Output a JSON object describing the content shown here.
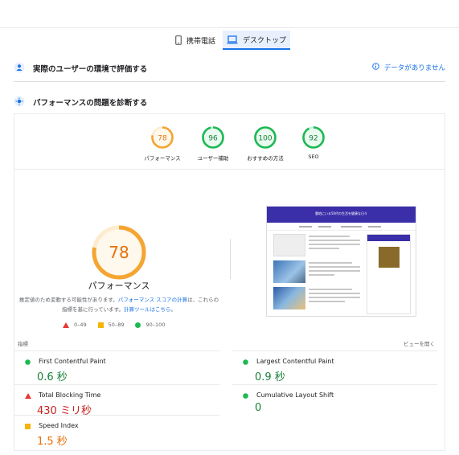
{
  "tabs": [
    {
      "label": "携帯電話",
      "icon": "smartphone-icon"
    },
    {
      "label": "デスクトップ",
      "icon": "laptop-icon",
      "selected": true
    }
  ],
  "field_section": {
    "title": "実際のユーザーの環境で評価する",
    "status": "データがありません"
  },
  "diagnose_section": {
    "title": "パフォーマンスの問題を診断する"
  },
  "category_scores": [
    {
      "label": "パフォーマンス",
      "score": "78",
      "color": "#f4a532"
    },
    {
      "label": "ユーザー補助",
      "score": "96",
      "color": "#1db954"
    },
    {
      "label": "おすすめの方法",
      "score": "100",
      "color": "#1db954"
    },
    {
      "label": "SEO",
      "score": "92",
      "color": "#1db954"
    }
  ],
  "main_score": {
    "value": "78",
    "value_fraction": 0.78,
    "label": "パフォーマンス",
    "note_prefix": "推定値のため変動する可能性があります。",
    "note_link1": "パフォーマンス スコアの計算",
    "note_mid": "は、これらの指標を基に行っています。",
    "note_link2": "計算ツールはこちら",
    "note_suffix": "。"
  },
  "legend": [
    {
      "range": "0–49"
    },
    {
      "range": "50–89"
    },
    {
      "range": "90–100"
    }
  ],
  "screenshot": {
    "header_title": "農地にいる50代の生活を健康な日々"
  },
  "metrics_header": {
    "left": "指標",
    "right": "ビューを開く"
  },
  "metrics": [
    {
      "name": "First Contentful Paint",
      "value": "0.6 秒",
      "status": "good"
    },
    {
      "name": "Largest Contentful Paint",
      "value": "0.9 秒",
      "status": "good"
    },
    {
      "name": "Total Blocking Time",
      "value": "430 ミリ秒",
      "status": "poor"
    },
    {
      "name": "Cumulative Layout Shift",
      "value": "0",
      "status": "good"
    },
    {
      "name": "Speed Index",
      "value": "1.5 秒",
      "status": "average"
    }
  ],
  "colors": {
    "good": "#1db954",
    "average": "#f4b400",
    "poor": "#e53935",
    "accent": "#1a73e8"
  }
}
